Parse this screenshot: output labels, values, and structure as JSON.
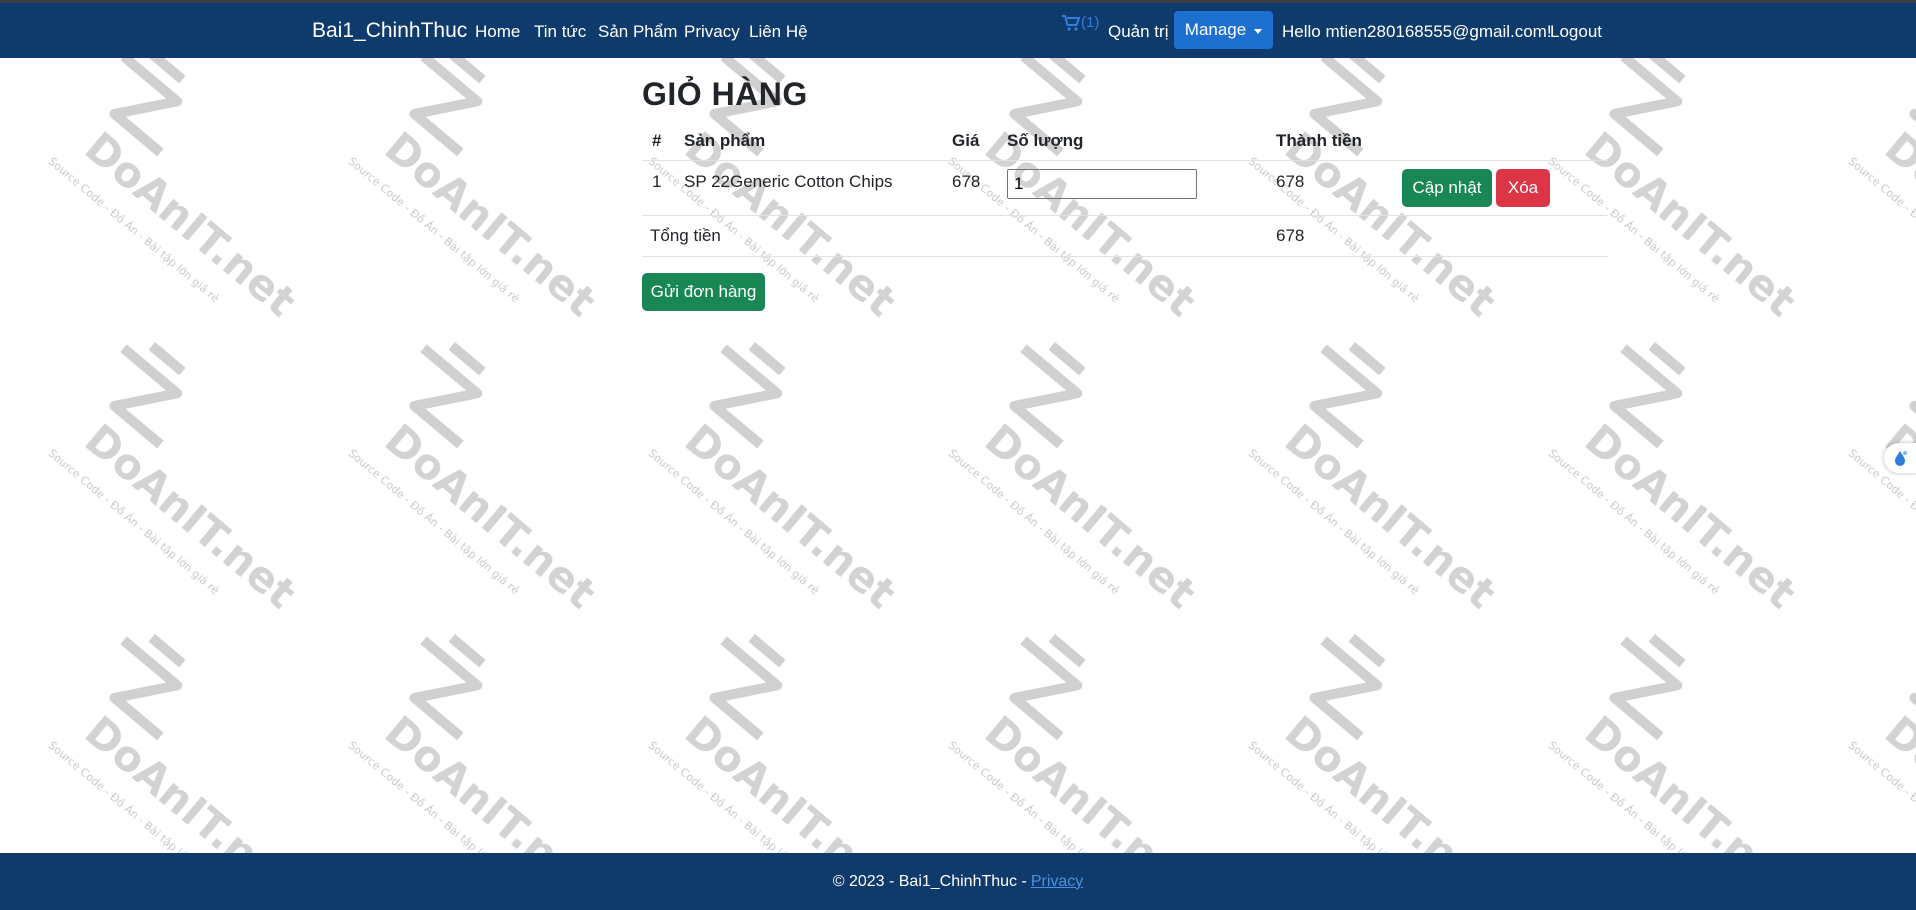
{
  "navbar": {
    "brand": "Bai1_ChinhThuc",
    "links": [
      "Home",
      "Tin tức",
      "Sản Phẩm",
      "Privacy",
      "Liên Hệ"
    ],
    "cart_count": "(1)",
    "admin": "Quản trị",
    "manage": "Manage",
    "greeting": "Hello mtien280168555@gmail.com!",
    "logout": "Logout"
  },
  "cart": {
    "title": "GIỎ HÀNG",
    "headers": [
      "#",
      "Sản phẩm",
      "Giá",
      "Số lượng",
      "Thành tiền"
    ],
    "rows": [
      {
        "index": "1",
        "product": "SP 22Generic Cotton Chips",
        "price": "678",
        "quantity": "1",
        "subtotal": "678"
      }
    ],
    "update_label": "Cập nhật",
    "delete_label": "Xóa",
    "total_label": "Tổng tiền",
    "total_value": "678",
    "submit_label": "Gửi đơn hàng"
  },
  "watermark": {
    "brand": "DoAnIT.net",
    "tagline": "Source Code - Đồ Án - Bài tập lớn giá rẻ"
  },
  "footer": {
    "text": "© 2023 - Bai1_ChinhThuc -",
    "privacy": "Privacy"
  },
  "colors": {
    "navbar": "#0e3b6b",
    "manage_button": "#1d6fd0",
    "success": "#198754",
    "danger": "#dc3545",
    "cart_icon": "#2f7de0"
  },
  "icons": [
    "cart-icon",
    "caret-down-icon",
    "side-widget-icon"
  ]
}
